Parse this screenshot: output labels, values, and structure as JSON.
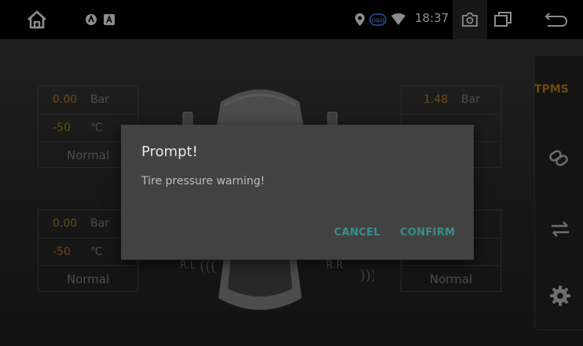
{
  "statusbar": {
    "time": "18:37",
    "obd_label": "OBD"
  },
  "sidebar": {
    "tpms_label": "TPMS",
    "items": [
      {
        "icon": "link-icon"
      },
      {
        "icon": "swap-icon"
      },
      {
        "icon": "gear-icon"
      }
    ]
  },
  "tires": {
    "front_left": {
      "pressure": "0.00",
      "pressure_unit": "Bar",
      "temp": "-50",
      "temp_unit": "℃",
      "status": "Normal"
    },
    "front_right": {
      "pressure": "1.48",
      "pressure_unit": "Bar"
    },
    "rear_left": {
      "pressure": "0.00",
      "pressure_unit": "Bar",
      "temp": "-50",
      "temp_unit": "℃",
      "status": "Normal"
    },
    "rear_right": {
      "status": "Normal"
    }
  },
  "car": {
    "rear_left_label": "R.L",
    "rear_right_label": "R.R"
  },
  "dialog": {
    "title": "Prompt!",
    "message": "Tire pressure warning!",
    "cancel_label": "CANCEL",
    "confirm_label": "CONFIRM"
  },
  "colors": {
    "accent": "#c18a27",
    "dialog_button": "#3d8c8a",
    "dialog_bg": "#424242"
  }
}
